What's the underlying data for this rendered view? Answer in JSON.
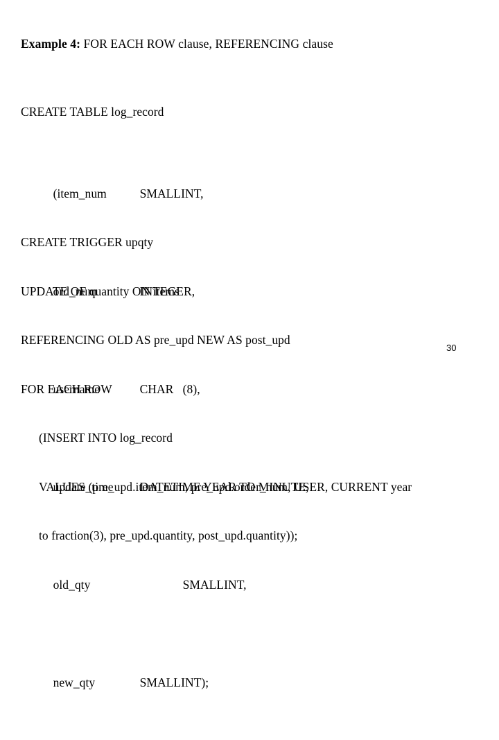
{
  "slide": {
    "title": {
      "lead": "Example 4:",
      "rest": " FOR EACH ROW clause, REFERENCING clause"
    },
    "create_table": {
      "header": "CREATE TABLE log_record",
      "columns": [
        {
          "name": "(item_num",
          "type": "SMALLINT,",
          "extra_indent": false
        },
        {
          "name": "ord_num",
          "type": "INTEGER,",
          "extra_indent": false
        },
        {
          "name": "username",
          "type": "CHAR   (8),",
          "extra_indent": false
        },
        {
          "name": "update_time",
          "type": "DATETIME YEAR TO MINUTE,",
          "extra_indent": false
        },
        {
          "name": "old_qty",
          "type": "SMALLINT,",
          "extra_indent": true
        },
        {
          "name": "new_qty",
          "type": "SMALLINT);",
          "extra_indent": false
        }
      ]
    },
    "trigger": {
      "lines": [
        "CREATE TRIGGER upqty",
        "UPDATE OF quantity ON items",
        "REFERENCING OLD AS pre_upd NEW AS post_upd",
        "FOR EACH ROW"
      ],
      "body_lines": [
        "(INSERT INTO log_record",
        "VALUES (pre_upd.item_num, pre_upd.order_num, USER, CURRENT year",
        "to fraction(3), pre_upd.quantity, post_upd.quantity));"
      ]
    },
    "page_number": "30"
  }
}
